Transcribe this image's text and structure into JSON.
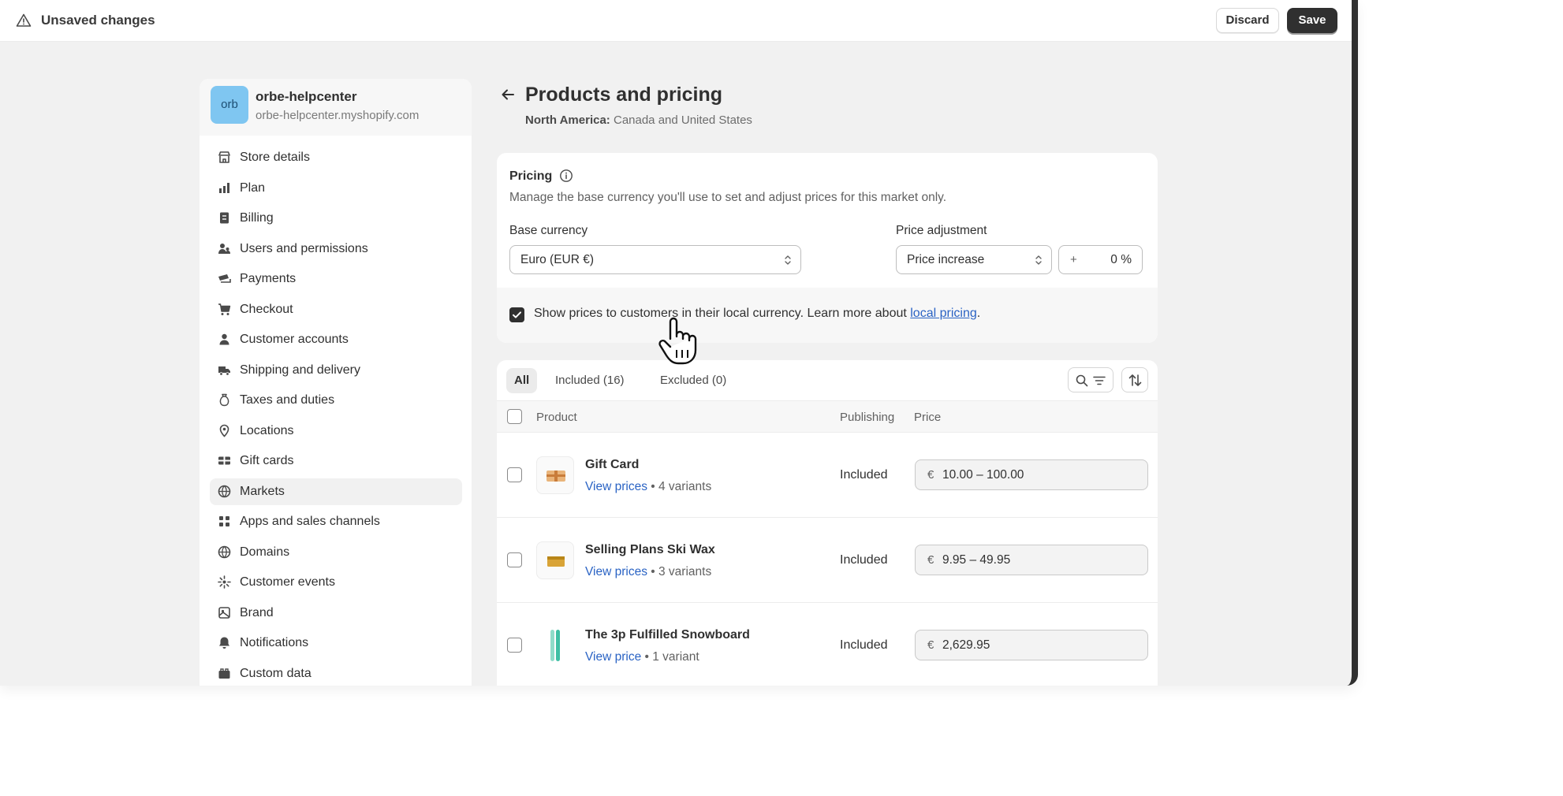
{
  "topbar": {
    "title": "Unsaved changes",
    "discard_label": "Discard",
    "save_label": "Save"
  },
  "store": {
    "avatar_text": "orb",
    "name": "orbe-helpcenter",
    "domain": "orbe-helpcenter.myshopify.com"
  },
  "sidebar": {
    "items": [
      {
        "label": "Store details",
        "icon": "store-icon"
      },
      {
        "label": "Plan",
        "icon": "plan-icon"
      },
      {
        "label": "Billing",
        "icon": "billing-icon"
      },
      {
        "label": "Users and permissions",
        "icon": "users-icon"
      },
      {
        "label": "Payments",
        "icon": "payments-icon"
      },
      {
        "label": "Checkout",
        "icon": "cart-icon"
      },
      {
        "label": "Customer accounts",
        "icon": "person-icon"
      },
      {
        "label": "Shipping and delivery",
        "icon": "truck-icon"
      },
      {
        "label": "Taxes and duties",
        "icon": "tax-bag-icon"
      },
      {
        "label": "Locations",
        "icon": "location-pin-icon"
      },
      {
        "label": "Gift cards",
        "icon": "gift-card-icon"
      },
      {
        "label": "Markets",
        "icon": "globe-icon",
        "active": true
      },
      {
        "label": "Apps and sales channels",
        "icon": "apps-icon"
      },
      {
        "label": "Domains",
        "icon": "globe-icon"
      },
      {
        "label": "Customer events",
        "icon": "events-icon"
      },
      {
        "label": "Brand",
        "icon": "brand-icon"
      },
      {
        "label": "Notifications",
        "icon": "bell-icon"
      },
      {
        "label": "Custom data",
        "icon": "custom-data-icon"
      }
    ]
  },
  "page": {
    "title": "Products and pricing",
    "subtitle_bold": "North America:",
    "subtitle_rest": " Canada and United States"
  },
  "pricing": {
    "title": "Pricing",
    "description": "Manage the base currency you'll use to set and adjust prices for this market only.",
    "base_currency_label": "Base currency",
    "base_currency_value": "Euro (EUR €)",
    "price_adjustment_label": "Price adjustment",
    "price_adjustment_value": "Price increase",
    "adjustment_sign": "+",
    "adjustment_percent": "0 %",
    "local_currency_checked": true,
    "local_currency_text": "Show prices to customers in their local currency. Learn more about ",
    "local_currency_link": "local pricing",
    "local_currency_suffix": "."
  },
  "products": {
    "tabs": [
      {
        "label": "All",
        "active": true
      },
      {
        "label": "Included (16)"
      },
      {
        "label": "Excluded (0)"
      }
    ],
    "columns": {
      "product": "Product",
      "publishing": "Publishing",
      "price": "Price"
    },
    "rows": [
      {
        "name": "Gift Card",
        "link": "View prices",
        "variants": " • 4 variants",
        "status": "Included",
        "currency": "€",
        "price": "10.00 – 100.00"
      },
      {
        "name": "Selling Plans Ski Wax",
        "link": "View prices",
        "variants": " • 3 variants",
        "status": "Included",
        "currency": "€",
        "price": "9.95 – 49.95"
      },
      {
        "name": "The 3p Fulfilled Snowboard",
        "link": "View price",
        "variants": " • 1 variant",
        "status": "Included",
        "currency": "€",
        "price": "2,629.95"
      }
    ]
  },
  "colors": {
    "primary_dark": "#303030",
    "link": "#2a63c4",
    "avatar": "#7fc6f1",
    "canvas": "#f1f1f1"
  }
}
